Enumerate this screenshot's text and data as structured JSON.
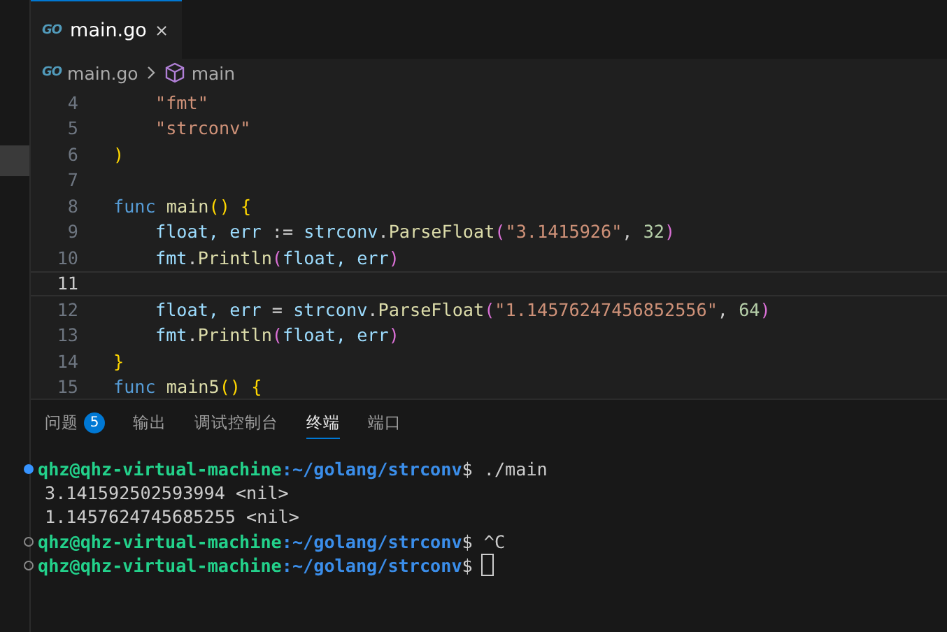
{
  "tabs": [
    {
      "icon": "GO",
      "label": "main.go",
      "selected": true
    }
  ],
  "breadcrumb": {
    "icon": "GO",
    "file": "main.go",
    "symbol": "main"
  },
  "code": {
    "lines": [
      {
        "number": "4",
        "current": false,
        "indented": true,
        "tokens": [
          {
            "kind": "str",
            "text": "\"fmt\""
          }
        ]
      },
      {
        "number": "5",
        "current": false,
        "indented": true,
        "tokens": [
          {
            "kind": "str",
            "text": "\"strconv\""
          }
        ]
      },
      {
        "number": "6",
        "current": false,
        "indented": false,
        "tokens": [
          {
            "kind": "bracket",
            "text": ")"
          }
        ]
      },
      {
        "number": "7",
        "current": false
      },
      {
        "number": "8",
        "current": false,
        "indented": false,
        "tokens": [
          {
            "kind": "kw",
            "text": "func "
          },
          {
            "kind": "fn",
            "text": "main"
          },
          {
            "kind": "bracket",
            "text": "() {"
          }
        ]
      },
      {
        "number": "9",
        "current": false,
        "indented": true,
        "tokens": [
          {
            "kind": "var",
            "text": "float, err"
          },
          {
            "kind": "plain",
            "text": " := "
          },
          {
            "kind": "var",
            "text": "strconv"
          },
          {
            "kind": "plain",
            "text": "."
          },
          {
            "kind": "fn",
            "text": "ParseFloat"
          },
          {
            "kind": "paren",
            "text": "("
          },
          {
            "kind": "str",
            "text": "\"3.1415926\""
          },
          {
            "kind": "plain",
            "text": ", "
          },
          {
            "kind": "num",
            "text": "32"
          },
          {
            "kind": "paren",
            "text": ")"
          }
        ]
      },
      {
        "number": "10",
        "current": false,
        "indented": true,
        "tokens": [
          {
            "kind": "var",
            "text": "fmt"
          },
          {
            "kind": "plain",
            "text": "."
          },
          {
            "kind": "fn",
            "text": "Println"
          },
          {
            "kind": "paren",
            "text": "("
          },
          {
            "kind": "var",
            "text": "float, err"
          },
          {
            "kind": "paren",
            "text": ")"
          }
        ]
      },
      {
        "number": "11",
        "current": true
      },
      {
        "number": "12",
        "current": false,
        "indented": true,
        "tokens": [
          {
            "kind": "var",
            "text": "float, err"
          },
          {
            "kind": "plain",
            "text": " = "
          },
          {
            "kind": "var",
            "text": "strconv"
          },
          {
            "kind": "plain",
            "text": "."
          },
          {
            "kind": "fn",
            "text": "ParseFloat"
          },
          {
            "kind": "paren",
            "text": "("
          },
          {
            "kind": "str",
            "text": "\"1.14576247456852556\""
          },
          {
            "kind": "plain",
            "text": ", "
          },
          {
            "kind": "num",
            "text": "64"
          },
          {
            "kind": "paren",
            "text": ")"
          }
        ]
      },
      {
        "number": "13",
        "current": false,
        "indented": true,
        "tokens": [
          {
            "kind": "var",
            "text": "fmt"
          },
          {
            "kind": "plain",
            "text": "."
          },
          {
            "kind": "fn",
            "text": "Println"
          },
          {
            "kind": "paren",
            "text": "("
          },
          {
            "kind": "var",
            "text": "float, err"
          },
          {
            "kind": "paren",
            "text": ")"
          }
        ]
      },
      {
        "number": "14",
        "current": false,
        "indented": false,
        "tokens": [
          {
            "kind": "bracket",
            "text": "}"
          }
        ]
      },
      {
        "number": "15",
        "current": false,
        "indented": false,
        "tokens": [
          {
            "kind": "kw",
            "text": "func "
          },
          {
            "kind": "fn",
            "text": "main5"
          },
          {
            "kind": "bracket",
            "text": "() {"
          }
        ]
      }
    ]
  },
  "panel_tabs": [
    {
      "label": "问题",
      "badge": "5",
      "selected": false
    },
    {
      "label": "输出",
      "selected": false
    },
    {
      "label": "调试控制台",
      "selected": false
    },
    {
      "label": "终端",
      "selected": true
    },
    {
      "label": "端口",
      "selected": false
    }
  ],
  "terminal": [
    {
      "kind": "prompt",
      "succeeded": true,
      "user": "qhz@qhz-virtual-machine",
      "path": ":~/golang/strconv",
      "symbol": "$",
      "command": "./main",
      "cursor": false
    },
    {
      "kind": "output",
      "text": "3.141592502593994 <nil>"
    },
    {
      "kind": "output",
      "text": "1.1457624745685255 <nil>"
    },
    {
      "kind": "prompt",
      "succeeded": false,
      "user": "qhz@qhz-virtual-machine",
      "path": ":~/golang/strconv",
      "symbol": "$",
      "command": "^C",
      "cursor": false
    },
    {
      "kind": "prompt",
      "succeeded": false,
      "user": "qhz@qhz-virtual-machine",
      "path": ":~/golang/strconv",
      "symbol": "$",
      "cursor": true
    }
  ]
}
